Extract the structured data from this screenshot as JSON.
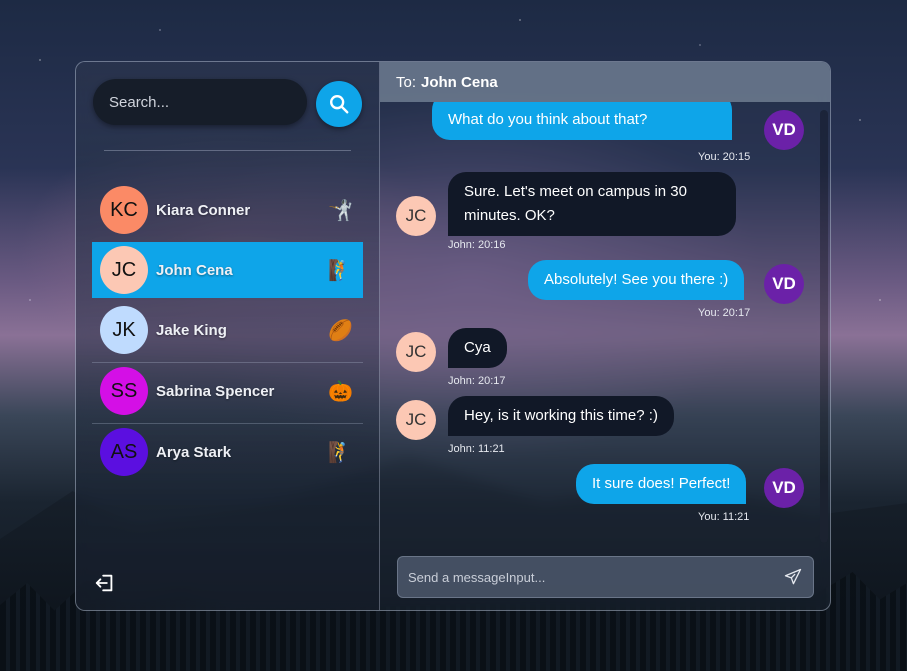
{
  "search": {
    "placeholder": "Search..."
  },
  "contacts": [
    {
      "initials": "KC",
      "name": "Kiara Conner",
      "emoji": "🤺",
      "avatar_color": "#fb8a66"
    },
    {
      "initials": "JC",
      "name": "John Cena",
      "emoji": "🧗",
      "avatar_color": "#fcc8b4"
    },
    {
      "initials": "JK",
      "name": "Jake King",
      "emoji": "🏉",
      "avatar_color": "#bfdbfe"
    },
    {
      "initials": "SS",
      "name": "Sabrina Spencer",
      "emoji": "🎃",
      "avatar_color": "#d40fe6"
    },
    {
      "initials": "AS",
      "name": "Arya Stark",
      "emoji": "🧗",
      "avatar_color": "#5b0fe0"
    }
  ],
  "chat": {
    "to_label": "To:",
    "to_name": "John Cena",
    "composer_placeholder": "Send a messageInput...",
    "messages": [
      {
        "text": "What do you think about that?",
        "sender": "VD",
        "meta": "You: 20:15"
      },
      {
        "text_line1": "Sure. Let's meet on campus in 30",
        "text_line2": "minutes. OK?",
        "sender": "JC",
        "meta": "John: 20:16"
      },
      {
        "text": "Absolutely! See you there :)",
        "sender": "VD",
        "meta": "You: 20:17"
      },
      {
        "text": "Cya",
        "sender": "JC",
        "meta": "John: 20:17"
      },
      {
        "text": "Hey, is it working this time? :)",
        "sender": "JC",
        "meta": "John: 11:21"
      },
      {
        "text": "It sure does! Perfect!",
        "sender": "VD",
        "meta": "You: 11:21"
      }
    ]
  },
  "colors": {
    "accent": "#0ea5e9",
    "incoming_bubble": "#111827",
    "vd_avatar": "#6b21a8"
  }
}
